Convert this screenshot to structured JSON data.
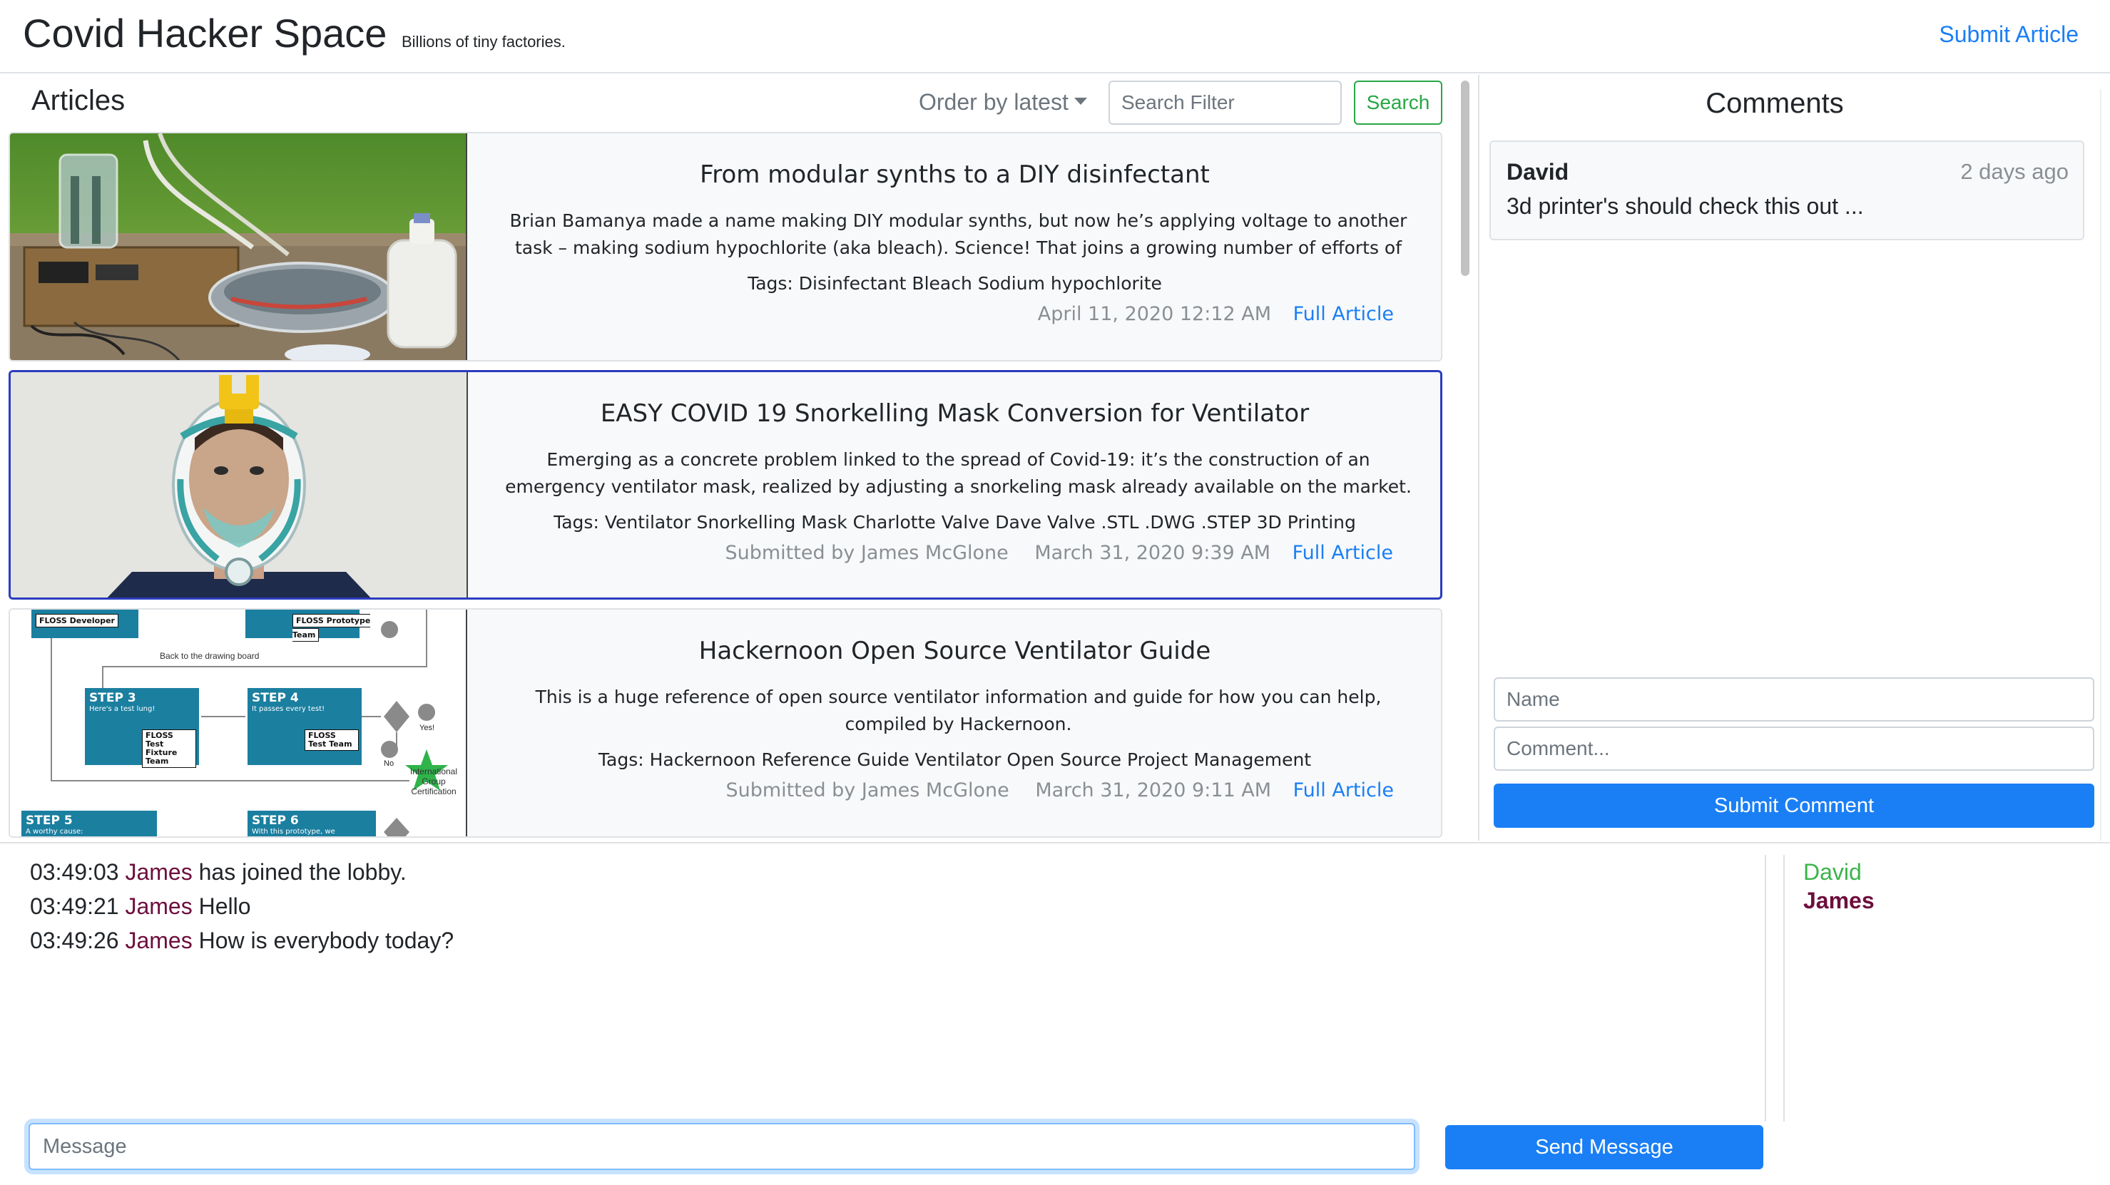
{
  "header": {
    "brand": "Covid Hacker Space",
    "tagline": "Billions of tiny factories.",
    "submit_article": "Submit Article"
  },
  "articles": {
    "title": "Articles",
    "order_label": "Order by latest",
    "search_placeholder": "Search Filter",
    "search_button": "Search",
    "items": [
      {
        "title": "From modular synths to a DIY disinfectant",
        "description": "Brian Bamanya made a name making DIY modular synths, but now he’s applying voltage to another task – making sodium hypochlorite (aka bleach). Science! That joins a growing number of efforts of DIYers turnin…",
        "tags": "Tags: Disinfectant Bleach Sodium hypochlorite",
        "submitted_by": "",
        "date": "April 11, 2020 12:12 AM",
        "link": "Full Article",
        "image": "bleach-apparatus-photo"
      },
      {
        "title": "EASY COVID 19 Snorkelling Mask Conversion for Ventilator",
        "description": "Emerging as a concrete problem linked to the spread of Covid-19: it’s the construction of an emergency ventilator mask, realized by adjusting a snorkeling mask already available on the market.",
        "tags": "Tags: Ventilator Snorkelling Mask Charlotte Valve Dave Valve .STL .DWG .STEP 3D Printing",
        "submitted_by": "Submitted by James McGlone",
        "date": "March 31, 2020 9:39 AM",
        "link": "Full Article",
        "image": "snorkel-mask-photo"
      },
      {
        "title": "Hackernoon Open Source Ventilator Guide",
        "description": "This is a huge reference of open source ventilator information and guide for how you can help, compiled by Hackernoon.",
        "tags": "Tags: Hackernoon Reference Guide Ventilator Open Source Project Management",
        "submitted_by": "Submitted by James McGlone",
        "date": "March 31, 2020 9:11 AM",
        "link": "Full Article",
        "image": "flowchart-diagram"
      }
    ],
    "flowchart": {
      "floss_developer": "FLOSS Developer",
      "floss_prototype": "FLOSS Prototype Team",
      "back_to_board": "Back to the drawing board",
      "step3": "STEP 3",
      "step3_sub": "Here's a test lung!",
      "step4": "STEP 4",
      "step4_sub": "It passes every test!",
      "fixture_team": "FLOSS Test Fixture Team",
      "test_team": "FLOSS Test Team",
      "step5": "STEP 5",
      "step5_sub": "A worthy cause:",
      "step6": "STEP 6",
      "step6_sub": "With this prototype, we",
      "no": "No",
      "yes": "Yes!",
      "certification": "International Group Certification"
    }
  },
  "comments": {
    "title": "Comments",
    "items": [
      {
        "author": "David",
        "time": "2 days ago",
        "text": "3d printer's should check this out ..."
      }
    ],
    "name_placeholder": "Name",
    "comment_placeholder": "Comment...",
    "submit_label": "Submit Comment"
  },
  "chat": {
    "messages": [
      {
        "time": "03:49:03",
        "user": "James",
        "text": "has joined the lobby."
      },
      {
        "time": "03:49:21",
        "user": "James",
        "text": "Hello"
      },
      {
        "time": "03:49:26",
        "user": "James",
        "text": "How is everybody today?"
      }
    ],
    "users": [
      "David",
      "James"
    ],
    "message_placeholder": "Message",
    "send_label": "Send Message"
  },
  "colors": {
    "link": "#1a7ff5",
    "primary_button": "#1a7ff5",
    "search_button": "#28a745",
    "active_card_border": "#2b3cbf",
    "chat_user": "#6d0e3d",
    "online_user_david": "#3cb44b"
  }
}
